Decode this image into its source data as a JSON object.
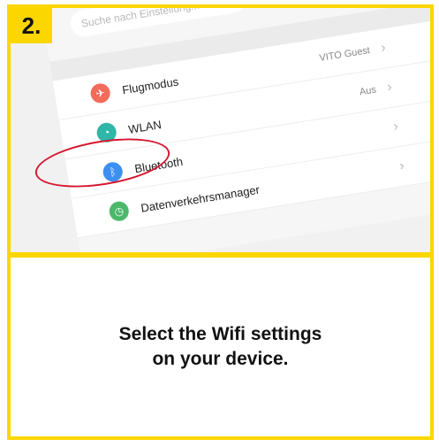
{
  "step": {
    "number": "2."
  },
  "settings": {
    "search_placeholder": "Suche nach Einstellung...",
    "items": [
      {
        "label": "Flugmodus",
        "value": "VITO Guest",
        "icon": "airplane-icon",
        "color": "#f26b5b"
      },
      {
        "label": "WLAN",
        "value": "Aus",
        "icon": "wifi-icon",
        "color": "#2fb6a7"
      },
      {
        "label": "Bluetooth",
        "value": "",
        "icon": "bluetooth-icon",
        "color": "#3d8ff2"
      },
      {
        "label": "Datenverkehrsmanager",
        "value": "",
        "icon": "data-icon",
        "color": "#4cb86a"
      }
    ]
  },
  "caption": {
    "line1": "Select the Wifi settings",
    "line2": "on your device."
  },
  "colors": {
    "accent": "#fcd600",
    "highlight": "#d6162f"
  }
}
